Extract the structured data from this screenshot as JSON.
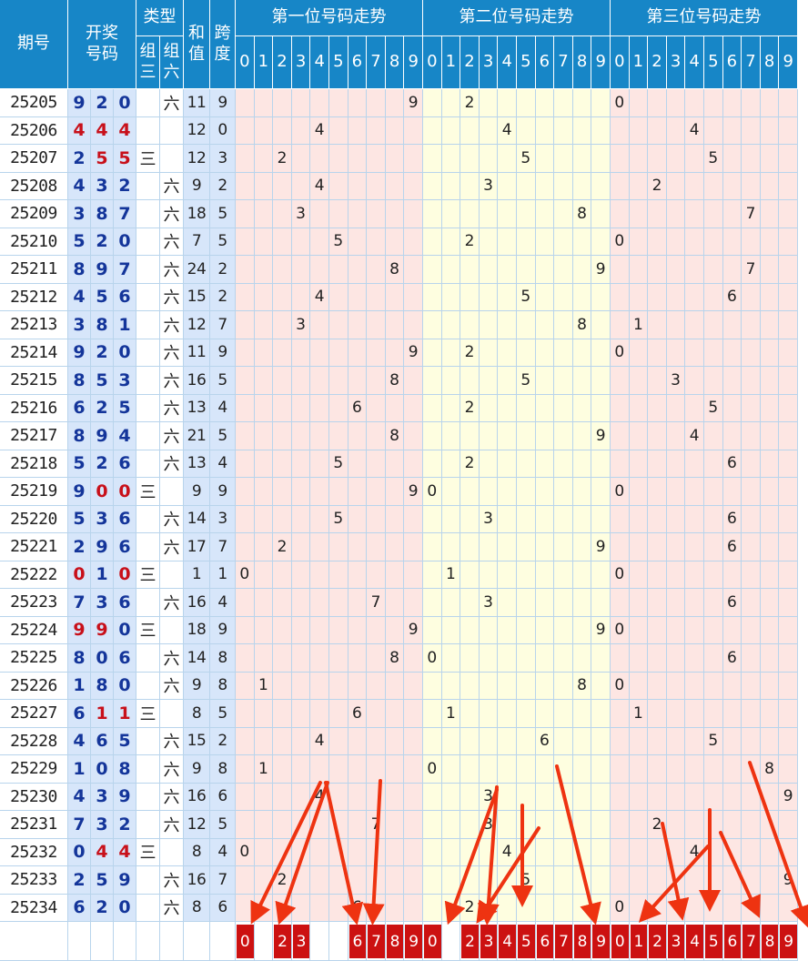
{
  "headers": {
    "period": "期号",
    "draw": "开奖号码",
    "type": "类型",
    "type_g3": "组三",
    "type_g6": "组六",
    "sum": "和值",
    "span": "跨度",
    "trend1": "第一位号码走势",
    "trend2": "第二位号码走势",
    "trend3": "第三位号码走势",
    "digits": [
      "0",
      "1",
      "2",
      "3",
      "4",
      "5",
      "6",
      "7",
      "8",
      "9"
    ]
  },
  "rows": [
    {
      "period": "25205",
      "d": [
        "9",
        "2",
        "0"
      ],
      "g3": "",
      "g6": "六",
      "sum": "11",
      "span": "9"
    },
    {
      "period": "25206",
      "d": [
        "4",
        "4",
        "4"
      ],
      "g3": "",
      "g6": "",
      "sum": "12",
      "span": "0"
    },
    {
      "period": "25207",
      "d": [
        "2",
        "5",
        "5"
      ],
      "g3": "三",
      "g6": "",
      "sum": "12",
      "span": "3"
    },
    {
      "period": "25208",
      "d": [
        "4",
        "3",
        "2"
      ],
      "g3": "",
      "g6": "六",
      "sum": "9",
      "span": "2"
    },
    {
      "period": "25209",
      "d": [
        "3",
        "8",
        "7"
      ],
      "g3": "",
      "g6": "六",
      "sum": "18",
      "span": "5"
    },
    {
      "period": "25210",
      "d": [
        "5",
        "2",
        "0"
      ],
      "g3": "",
      "g6": "六",
      "sum": "7",
      "span": "5"
    },
    {
      "period": "25211",
      "d": [
        "8",
        "9",
        "7"
      ],
      "g3": "",
      "g6": "六",
      "sum": "24",
      "span": "2"
    },
    {
      "period": "25212",
      "d": [
        "4",
        "5",
        "6"
      ],
      "g3": "",
      "g6": "六",
      "sum": "15",
      "span": "2"
    },
    {
      "period": "25213",
      "d": [
        "3",
        "8",
        "1"
      ],
      "g3": "",
      "g6": "六",
      "sum": "12",
      "span": "7"
    },
    {
      "period": "25214",
      "d": [
        "9",
        "2",
        "0"
      ],
      "g3": "",
      "g6": "六",
      "sum": "11",
      "span": "9"
    },
    {
      "period": "25215",
      "d": [
        "8",
        "5",
        "3"
      ],
      "g3": "",
      "g6": "六",
      "sum": "16",
      "span": "5"
    },
    {
      "period": "25216",
      "d": [
        "6",
        "2",
        "5"
      ],
      "g3": "",
      "g6": "六",
      "sum": "13",
      "span": "4"
    },
    {
      "period": "25217",
      "d": [
        "8",
        "9",
        "4"
      ],
      "g3": "",
      "g6": "六",
      "sum": "21",
      "span": "5"
    },
    {
      "period": "25218",
      "d": [
        "5",
        "2",
        "6"
      ],
      "g3": "",
      "g6": "六",
      "sum": "13",
      "span": "4"
    },
    {
      "period": "25219",
      "d": [
        "9",
        "0",
        "0"
      ],
      "g3": "三",
      "g6": "",
      "sum": "9",
      "span": "9"
    },
    {
      "period": "25220",
      "d": [
        "5",
        "3",
        "6"
      ],
      "g3": "",
      "g6": "六",
      "sum": "14",
      "span": "3"
    },
    {
      "period": "25221",
      "d": [
        "2",
        "9",
        "6"
      ],
      "g3": "",
      "g6": "六",
      "sum": "17",
      "span": "7"
    },
    {
      "period": "25222",
      "d": [
        "0",
        "1",
        "0"
      ],
      "g3": "三",
      "g6": "",
      "sum": "1",
      "span": "1"
    },
    {
      "period": "25223",
      "d": [
        "7",
        "3",
        "6"
      ],
      "g3": "",
      "g6": "六",
      "sum": "16",
      "span": "4"
    },
    {
      "period": "25224",
      "d": [
        "9",
        "9",
        "0"
      ],
      "g3": "三",
      "g6": "",
      "sum": "18",
      "span": "9"
    },
    {
      "period": "25225",
      "d": [
        "8",
        "0",
        "6"
      ],
      "g3": "",
      "g6": "六",
      "sum": "14",
      "span": "8"
    },
    {
      "period": "25226",
      "d": [
        "1",
        "8",
        "0"
      ],
      "g3": "",
      "g6": "六",
      "sum": "9",
      "span": "8"
    },
    {
      "period": "25227",
      "d": [
        "6",
        "1",
        "1"
      ],
      "g3": "三",
      "g6": "",
      "sum": "8",
      "span": "5"
    },
    {
      "period": "25228",
      "d": [
        "4",
        "6",
        "5"
      ],
      "g3": "",
      "g6": "六",
      "sum": "15",
      "span": "2"
    },
    {
      "period": "25229",
      "d": [
        "1",
        "0",
        "8"
      ],
      "g3": "",
      "g6": "六",
      "sum": "9",
      "span": "8"
    },
    {
      "period": "25230",
      "d": [
        "4",
        "3",
        "9"
      ],
      "g3": "",
      "g6": "六",
      "sum": "16",
      "span": "6"
    },
    {
      "period": "25231",
      "d": [
        "7",
        "3",
        "2"
      ],
      "g3": "",
      "g6": "六",
      "sum": "12",
      "span": "5"
    },
    {
      "period": "25232",
      "d": [
        "0",
        "4",
        "4"
      ],
      "g3": "三",
      "g6": "",
      "sum": "8",
      "span": "4"
    },
    {
      "period": "25233",
      "d": [
        "2",
        "5",
        "9"
      ],
      "g3": "",
      "g6": "六",
      "sum": "16",
      "span": "7"
    },
    {
      "period": "25234",
      "d": [
        "6",
        "2",
        "0"
      ],
      "g3": "",
      "g6": "六",
      "sum": "8",
      "span": "6"
    }
  ],
  "picks": {
    "pos1": [
      "0",
      "2",
      "3",
      "6",
      "7",
      "8",
      "9"
    ],
    "pos2": [
      "0",
      "2",
      "3",
      "4",
      "5",
      "6",
      "7",
      "8",
      "9"
    ],
    "pos3": [
      "0",
      "1",
      "2",
      "3",
      "4",
      "5",
      "6",
      "7",
      "8",
      "9"
    ]
  },
  "colors": {
    "header_bg": "#1786c7",
    "header_text": "#ffffff",
    "digit_blue": "#14359a",
    "digit_red": "#c8101a",
    "trend1_bg": "#fde6e3",
    "trend2_bg": "#fefee0",
    "trend3_bg": "#fde6e3",
    "pick_bg": "#cc1111",
    "arrow": "#ee3311"
  }
}
